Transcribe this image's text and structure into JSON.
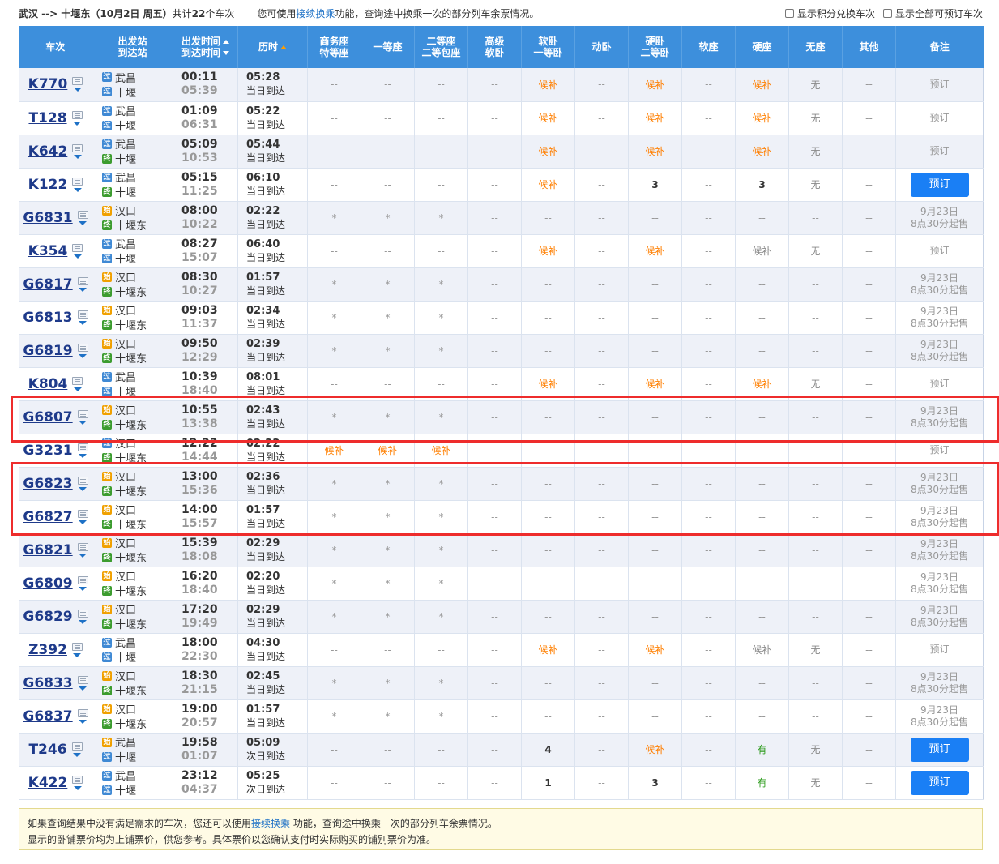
{
  "top": {
    "route": "武汉 --> 十堰东（10月2日  周五）",
    "total_prefix": "共计",
    "total_count": "22",
    "total_suffix": "个车次",
    "hint_prefix": "您可使用",
    "hint_link": "接续换乘",
    "hint_suffix": "功能，查询途中换乘一次的部分列车余票情况。",
    "cb1": "显示积分兑换车次",
    "cb2": "显示全部可预订车次"
  },
  "headers": {
    "train": "车次",
    "station_a": "出发站",
    "station_b": "到达站",
    "time_a": "出发时间",
    "time_b": "到达时间",
    "duration": "历时",
    "biz_a": "商务座",
    "biz_b": "特等座",
    "first": "一等座",
    "second_a": "二等座",
    "second_b": "二等包座",
    "hsoft_a": "高级",
    "hsoft_b": "软卧",
    "soft_a": "软卧",
    "soft_b": "一等卧",
    "dong": "动卧",
    "hard_a": "硬卧",
    "hard_b": "二等卧",
    "softseat": "软座",
    "hardseat": "硬座",
    "noseat": "无座",
    "other": "其他",
    "remark": "备注"
  },
  "tags": {
    "guo": "过",
    "shi": "始",
    "zhong": "终"
  },
  "rows": [
    {
      "no": "K770",
      "from": "武昌",
      "ft": "guo",
      "to": "十堰",
      "tt": "guo",
      "dep": "00:11",
      "arr": "05:39",
      "dur": "05:28",
      "day": "当日到达",
      "seats": [
        "--",
        "--",
        "--",
        "--",
        "候补",
        "--",
        "候补",
        "--",
        "候补",
        "无",
        "--"
      ],
      "remark": "预订",
      "rtype": "text"
    },
    {
      "no": "T128",
      "from": "武昌",
      "ft": "guo",
      "to": "十堰",
      "tt": "guo",
      "dep": "01:09",
      "arr": "06:31",
      "dur": "05:22",
      "day": "当日到达",
      "seats": [
        "--",
        "--",
        "--",
        "--",
        "候补",
        "--",
        "候补",
        "--",
        "候补",
        "无",
        "--"
      ],
      "remark": "预订",
      "rtype": "text"
    },
    {
      "no": "K642",
      "from": "武昌",
      "ft": "guo",
      "to": "十堰",
      "tt": "zhong",
      "dep": "05:09",
      "arr": "10:53",
      "dur": "05:44",
      "day": "当日到达",
      "seats": [
        "--",
        "--",
        "--",
        "--",
        "候补",
        "--",
        "候补",
        "--",
        "候补",
        "无",
        "--"
      ],
      "remark": "预订",
      "rtype": "text"
    },
    {
      "no": "K122",
      "from": "武昌",
      "ft": "guo",
      "to": "十堰",
      "tt": "zhong",
      "dep": "05:15",
      "arr": "11:25",
      "dur": "06:10",
      "day": "当日到达",
      "seats": [
        "--",
        "--",
        "--",
        "--",
        "候补",
        "--",
        "3",
        "--",
        "3",
        "无",
        "--"
      ],
      "remark": "预订",
      "rtype": "button"
    },
    {
      "no": "G6831",
      "from": "汉口",
      "ft": "shi",
      "to": "十堰东",
      "tt": "zhong",
      "dep": "08:00",
      "arr": "10:22",
      "dur": "02:22",
      "day": "当日到达",
      "seats": [
        "*",
        "*",
        "*",
        "--",
        "--",
        "--",
        "--",
        "--",
        "--",
        "--",
        "--"
      ],
      "remark": "9月23日\n8点30分起售",
      "rtype": "note"
    },
    {
      "no": "K354",
      "from": "武昌",
      "ft": "guo",
      "to": "十堰",
      "tt": "guo",
      "dep": "08:27",
      "arr": "15:07",
      "dur": "06:40",
      "day": "当日到达",
      "seats": [
        "--",
        "--",
        "--",
        "--",
        "候补",
        "--",
        "候补",
        "--",
        "候补g",
        "无",
        "--"
      ],
      "remark": "预订",
      "rtype": "text"
    },
    {
      "no": "G6817",
      "from": "汉口",
      "ft": "shi",
      "to": "十堰东",
      "tt": "zhong",
      "dep": "08:30",
      "arr": "10:27",
      "dur": "01:57",
      "day": "当日到达",
      "seats": [
        "*",
        "*",
        "*",
        "--",
        "--",
        "--",
        "--",
        "--",
        "--",
        "--",
        "--"
      ],
      "remark": "9月23日\n8点30分起售",
      "rtype": "note"
    },
    {
      "no": "G6813",
      "from": "汉口",
      "ft": "shi",
      "to": "十堰东",
      "tt": "zhong",
      "dep": "09:03",
      "arr": "11:37",
      "dur": "02:34",
      "day": "当日到达",
      "seats": [
        "*",
        "*",
        "*",
        "--",
        "--",
        "--",
        "--",
        "--",
        "--",
        "--",
        "--"
      ],
      "remark": "9月23日\n8点30分起售",
      "rtype": "note"
    },
    {
      "no": "G6819",
      "from": "汉口",
      "ft": "shi",
      "to": "十堰东",
      "tt": "zhong",
      "dep": "09:50",
      "arr": "12:29",
      "dur": "02:39",
      "day": "当日到达",
      "seats": [
        "*",
        "*",
        "*",
        "--",
        "--",
        "--",
        "--",
        "--",
        "--",
        "--",
        "--"
      ],
      "remark": "9月23日\n8点30分起售",
      "rtype": "note"
    },
    {
      "no": "K804",
      "from": "武昌",
      "ft": "guo",
      "to": "十堰",
      "tt": "guo",
      "dep": "10:39",
      "arr": "18:40",
      "dur": "08:01",
      "day": "当日到达",
      "seats": [
        "--",
        "--",
        "--",
        "--",
        "候补",
        "--",
        "候补",
        "--",
        "候补",
        "无",
        "--"
      ],
      "remark": "预订",
      "rtype": "text"
    },
    {
      "no": "G6807",
      "from": "汉口",
      "ft": "shi",
      "to": "十堰东",
      "tt": "zhong",
      "dep": "10:55",
      "arr": "13:38",
      "dur": "02:43",
      "day": "当日到达",
      "seats": [
        "*",
        "*",
        "*",
        "--",
        "--",
        "--",
        "--",
        "--",
        "--",
        "--",
        "--"
      ],
      "remark": "9月23日\n8点30分起售",
      "rtype": "note"
    },
    {
      "no": "G3231",
      "from": "汉口",
      "ft": "guo",
      "to": "十堰东",
      "tt": "zhong",
      "dep": "12:22",
      "arr": "14:44",
      "dur": "02:22",
      "day": "当日到达",
      "seats": [
        "候补",
        "候补",
        "候补",
        "--",
        "--",
        "--",
        "--",
        "--",
        "--",
        "--",
        "--"
      ],
      "remark": "预订",
      "rtype": "text"
    },
    {
      "no": "G6823",
      "from": "汉口",
      "ft": "shi",
      "to": "十堰东",
      "tt": "zhong",
      "dep": "13:00",
      "arr": "15:36",
      "dur": "02:36",
      "day": "当日到达",
      "seats": [
        "*",
        "*",
        "*",
        "--",
        "--",
        "--",
        "--",
        "--",
        "--",
        "--",
        "--"
      ],
      "remark": "9月23日\n8点30分起售",
      "rtype": "note"
    },
    {
      "no": "G6827",
      "from": "汉口",
      "ft": "shi",
      "to": "十堰东",
      "tt": "zhong",
      "dep": "14:00",
      "arr": "15:57",
      "dur": "01:57",
      "day": "当日到达",
      "seats": [
        "*",
        "*",
        "*",
        "--",
        "--",
        "--",
        "--",
        "--",
        "--",
        "--",
        "--"
      ],
      "remark": "9月23日\n8点30分起售",
      "rtype": "note"
    },
    {
      "no": "G6821",
      "from": "汉口",
      "ft": "shi",
      "to": "十堰东",
      "tt": "zhong",
      "dep": "15:39",
      "arr": "18:08",
      "dur": "02:29",
      "day": "当日到达",
      "seats": [
        "*",
        "*",
        "*",
        "--",
        "--",
        "--",
        "--",
        "--",
        "--",
        "--",
        "--"
      ],
      "remark": "9月23日\n8点30分起售",
      "rtype": "note"
    },
    {
      "no": "G6809",
      "from": "汉口",
      "ft": "shi",
      "to": "十堰东",
      "tt": "zhong",
      "dep": "16:20",
      "arr": "18:40",
      "dur": "02:20",
      "day": "当日到达",
      "seats": [
        "*",
        "*",
        "*",
        "--",
        "--",
        "--",
        "--",
        "--",
        "--",
        "--",
        "--"
      ],
      "remark": "9月23日\n8点30分起售",
      "rtype": "note"
    },
    {
      "no": "G6829",
      "from": "汉口",
      "ft": "shi",
      "to": "十堰东",
      "tt": "zhong",
      "dep": "17:20",
      "arr": "19:49",
      "dur": "02:29",
      "day": "当日到达",
      "seats": [
        "*",
        "*",
        "*",
        "--",
        "--",
        "--",
        "--",
        "--",
        "--",
        "--",
        "--"
      ],
      "remark": "9月23日\n8点30分起售",
      "rtype": "note"
    },
    {
      "no": "Z392",
      "from": "武昌",
      "ft": "guo",
      "to": "十堰",
      "tt": "guo",
      "dep": "18:00",
      "arr": "22:30",
      "dur": "04:30",
      "day": "当日到达",
      "seats": [
        "--",
        "--",
        "--",
        "--",
        "候补",
        "--",
        "候补",
        "--",
        "候补g",
        "无",
        "--"
      ],
      "remark": "预订",
      "rtype": "text"
    },
    {
      "no": "G6833",
      "from": "汉口",
      "ft": "shi",
      "to": "十堰东",
      "tt": "zhong",
      "dep": "18:30",
      "arr": "21:15",
      "dur": "02:45",
      "day": "当日到达",
      "seats": [
        "*",
        "*",
        "*",
        "--",
        "--",
        "--",
        "--",
        "--",
        "--",
        "--",
        "--"
      ],
      "remark": "9月23日\n8点30分起售",
      "rtype": "note"
    },
    {
      "no": "G6837",
      "from": "汉口",
      "ft": "shi",
      "to": "十堰东",
      "tt": "zhong",
      "dep": "19:00",
      "arr": "20:57",
      "dur": "01:57",
      "day": "当日到达",
      "seats": [
        "*",
        "*",
        "*",
        "--",
        "--",
        "--",
        "--",
        "--",
        "--",
        "--",
        "--"
      ],
      "remark": "9月23日\n8点30分起售",
      "rtype": "note"
    },
    {
      "no": "T246",
      "from": "武昌",
      "ft": "shi",
      "to": "十堰",
      "tt": "guo",
      "dep": "19:58",
      "arr": "01:07",
      "dur": "05:09",
      "day": "次日到达",
      "seats": [
        "--",
        "--",
        "--",
        "--",
        "4",
        "--",
        "候补",
        "--",
        "有",
        "无",
        "--"
      ],
      "remark": "预订",
      "rtype": "button"
    },
    {
      "no": "K422",
      "from": "武昌",
      "ft": "guo",
      "to": "十堰",
      "tt": "guo",
      "dep": "23:12",
      "arr": "04:37",
      "dur": "05:25",
      "day": "次日到达",
      "seats": [
        "--",
        "--",
        "--",
        "--",
        "1",
        "--",
        "3",
        "--",
        "有",
        "无",
        "--"
      ],
      "remark": "预订",
      "rtype": "button"
    }
  ],
  "footer": {
    "line1_prefix": "如果查询结果中没有满足需求的车次，您还可以使用",
    "line1_link": "接续换乘",
    "line1_suffix": " 功能，查询途中换乘一次的部分列车余票情况。",
    "line2": "显示的卧铺票价均为上铺票价，供您参考。具体票价以您确认支付时实际购买的铺别票价为准。"
  },
  "colors": {
    "header_bg": "#3d8fdc",
    "highlight_box": "#ee2c2c",
    "booking_button": "#1a7ff5",
    "candidate": "#ff7f00",
    "available": "#2e9c1e"
  }
}
